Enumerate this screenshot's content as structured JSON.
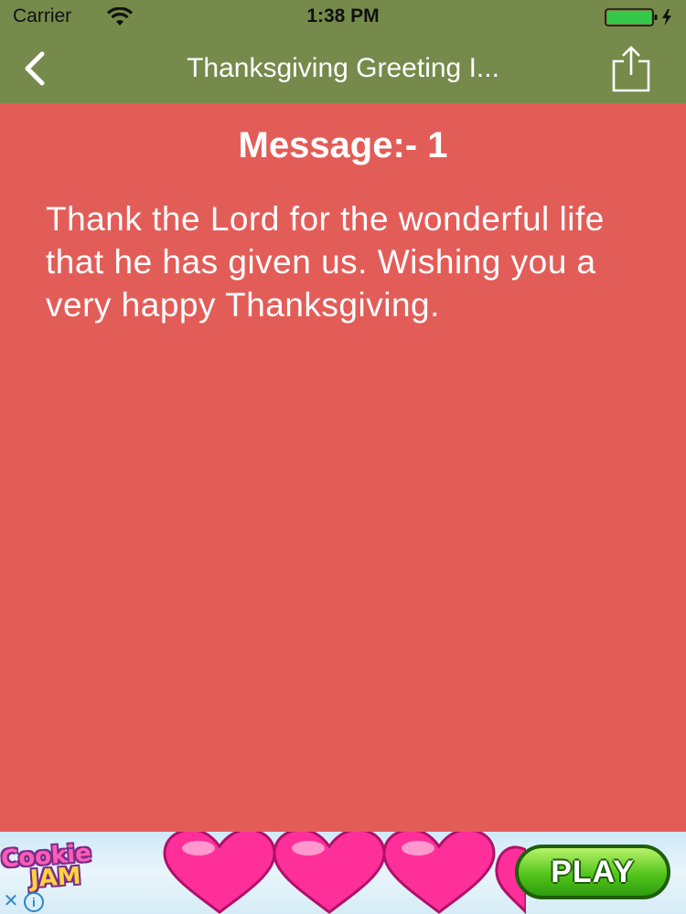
{
  "status_bar": {
    "carrier": "Carrier",
    "time": "1:38 PM",
    "icons": [
      "wifi-icon",
      "battery-icon",
      "charging-icon"
    ],
    "battery_color": "#35c94a"
  },
  "nav_bar": {
    "title": "Thanksgiving Greeting I...",
    "back_icon": "chevron-left-icon",
    "share_icon": "share-icon",
    "background": "#768a4b"
  },
  "content": {
    "heading": "Message:- 1",
    "message": "Thank the Lord for the wonderful life that he has given us. Wishing you a very happy Thanksgiving.",
    "background": "#e35d58"
  },
  "ad": {
    "logo_line1": "Cookie",
    "logo_line2": "JAM",
    "close_glyph": "✕",
    "info_glyph": "i",
    "play_label": "PLAY",
    "heart_color": "#ff2f9a"
  }
}
